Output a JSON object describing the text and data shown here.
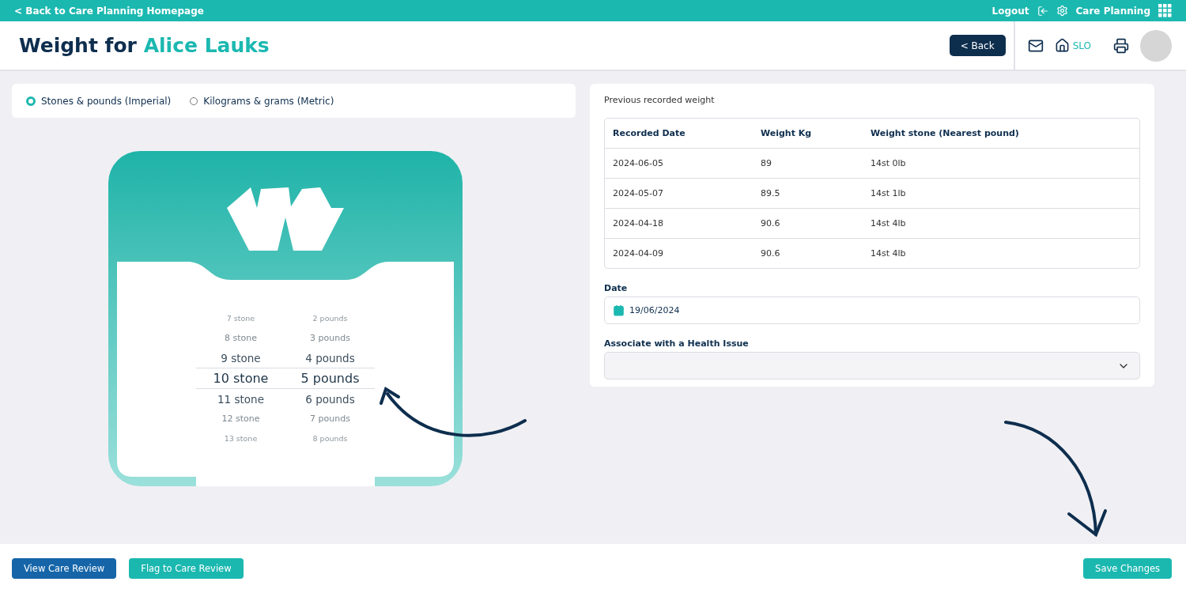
{
  "top_bar": {
    "back_link": "< Back to Care Planning Homepage",
    "logout": "Logout",
    "app_name": "Care Planning"
  },
  "header": {
    "title": "Weight for",
    "resident": "Alice Lauks",
    "back_button": "< Back",
    "home_label": "SLO"
  },
  "units": [
    {
      "label": "Stones & pounds (Imperial)",
      "selected": true
    },
    {
      "label": "Kilograms & grams (Metric)",
      "selected": false
    }
  ],
  "picker": {
    "rows": [
      {
        "stone": "7 stone",
        "pounds": "2 pounds",
        "selected": false
      },
      {
        "stone": "8 stone",
        "pounds": "3 pounds",
        "selected": false
      },
      {
        "stone": "9 stone",
        "pounds": "4 pounds",
        "selected": false
      },
      {
        "stone": "10 stone",
        "pounds": "5 pounds",
        "selected": true
      },
      {
        "stone": "11 stone",
        "pounds": "6 pounds",
        "selected": false
      },
      {
        "stone": "12 stone",
        "pounds": "7 pounds",
        "selected": false
      },
      {
        "stone": "13 stone",
        "pounds": "8 pounds",
        "selected": false
      }
    ]
  },
  "previous": {
    "title": "Previous recorded weight",
    "columns": [
      "Recorded Date",
      "Weight Kg",
      "Weight stone (Nearest pound)"
    ],
    "rows": [
      [
        "2024-06-05",
        "89",
        "14st 0lb"
      ],
      [
        "2024-05-07",
        "89.5",
        "14st 1lb"
      ],
      [
        "2024-04-18",
        "90.6",
        "14st 4lb"
      ],
      [
        "2024-04-09",
        "90.6",
        "14st 4lb"
      ]
    ]
  },
  "date": {
    "label": "Date",
    "value": "19/06/2024"
  },
  "health_issue": {
    "label": "Associate with a Health Issue"
  },
  "footer": {
    "buttons": [
      {
        "label": "View Care Review",
        "kind": "primary"
      },
      {
        "label": "Flag to Care Review",
        "kind": "secondary"
      },
      {
        "label": "Save Changes",
        "kind": "save"
      }
    ]
  }
}
